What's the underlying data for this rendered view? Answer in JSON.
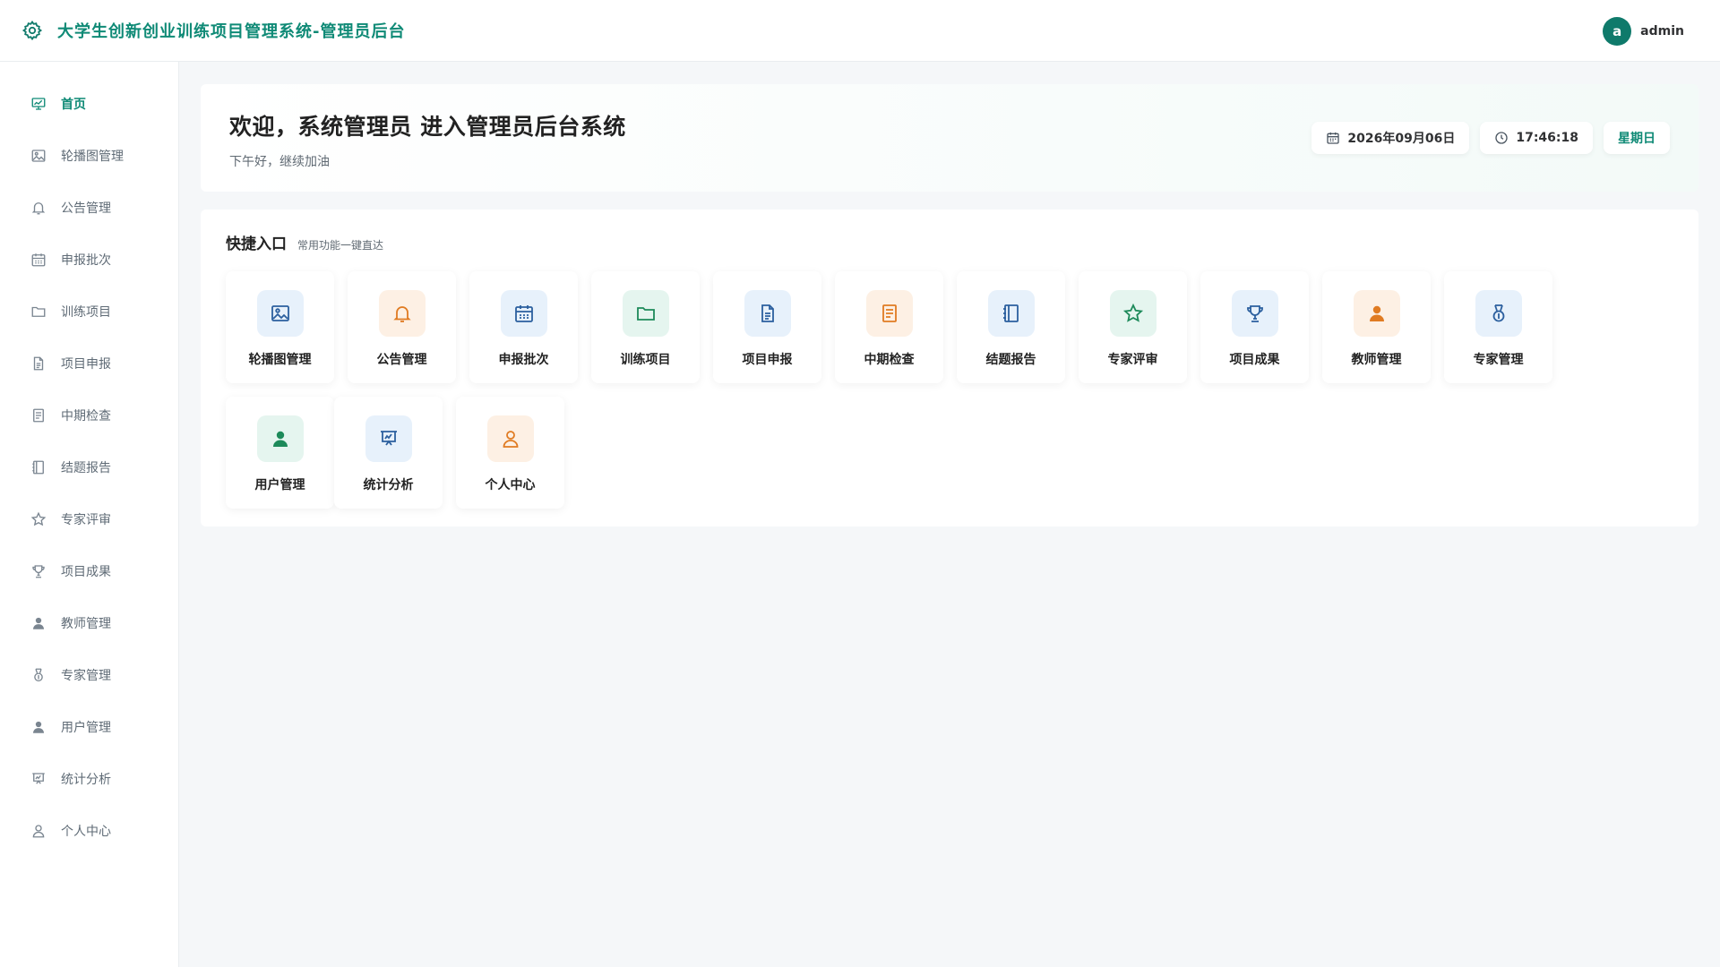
{
  "app": {
    "title": "大学生创新创业训练项目管理系统-管理员后台",
    "user": {
      "avatar_letter": "a",
      "name": "admin"
    }
  },
  "sidebar": {
    "items": [
      {
        "label": "首页",
        "icon": "chart-icon",
        "active": true
      },
      {
        "label": "轮播图管理",
        "icon": "image-icon"
      },
      {
        "label": "公告管理",
        "icon": "bell-icon"
      },
      {
        "label": "申报批次",
        "icon": "calendar-icon"
      },
      {
        "label": "训练项目",
        "icon": "folder-icon"
      },
      {
        "label": "项目申报",
        "icon": "document-icon"
      },
      {
        "label": "中期检查",
        "icon": "checklist-icon"
      },
      {
        "label": "结题报告",
        "icon": "notebook-icon"
      },
      {
        "label": "专家评审",
        "icon": "star-icon"
      },
      {
        "label": "项目成果",
        "icon": "trophy-icon"
      },
      {
        "label": "教师管理",
        "icon": "user-filled-icon"
      },
      {
        "label": "专家管理",
        "icon": "medal-icon"
      },
      {
        "label": "用户管理",
        "icon": "user-filled-icon"
      },
      {
        "label": "统计分析",
        "icon": "presentation-icon"
      },
      {
        "label": "个人中心",
        "icon": "user-outline-icon"
      }
    ]
  },
  "welcome": {
    "title": "欢迎，系统管理员 进入管理员后台系统",
    "greeting": "下午好，继续加油",
    "date": "2026年09月06日",
    "time": "17:46:18",
    "weekday": "星期日"
  },
  "quick": {
    "title": "快捷入口",
    "subtitle": "常用功能一键直达",
    "items": [
      {
        "label": "轮播图管理",
        "icon": "image-icon",
        "tone": "blue"
      },
      {
        "label": "公告管理",
        "icon": "bell-icon",
        "tone": "orange"
      },
      {
        "label": "申报批次",
        "icon": "calendar-icon",
        "tone": "blue"
      },
      {
        "label": "训练项目",
        "icon": "folder-icon",
        "tone": "green"
      },
      {
        "label": "项目申报",
        "icon": "document-icon",
        "tone": "blue"
      },
      {
        "label": "中期检查",
        "icon": "checklist-icon",
        "tone": "orange"
      },
      {
        "label": "结题报告",
        "icon": "notebook-icon",
        "tone": "blue"
      },
      {
        "label": "专家评审",
        "icon": "star-icon",
        "tone": "green"
      },
      {
        "label": "项目成果",
        "icon": "trophy-icon",
        "tone": "blue"
      },
      {
        "label": "教师管理",
        "icon": "user-filled-icon",
        "tone": "orange"
      },
      {
        "label": "专家管理",
        "icon": "medal-icon",
        "tone": "blue"
      },
      {
        "label": "用户管理",
        "icon": "user-filled-icon",
        "tone": "green"
      },
      {
        "label": "统计分析",
        "icon": "presentation-icon",
        "tone": "blue"
      },
      {
        "label": "个人中心",
        "icon": "user-outline-icon",
        "tone": "orange"
      }
    ]
  },
  "colors": {
    "brand": "#0f8a76",
    "avatar": "#0f7a6b",
    "tile_blue": "#e7f1fb",
    "tile_orange": "#fdf0e4",
    "tile_green": "#e5f5ef"
  }
}
